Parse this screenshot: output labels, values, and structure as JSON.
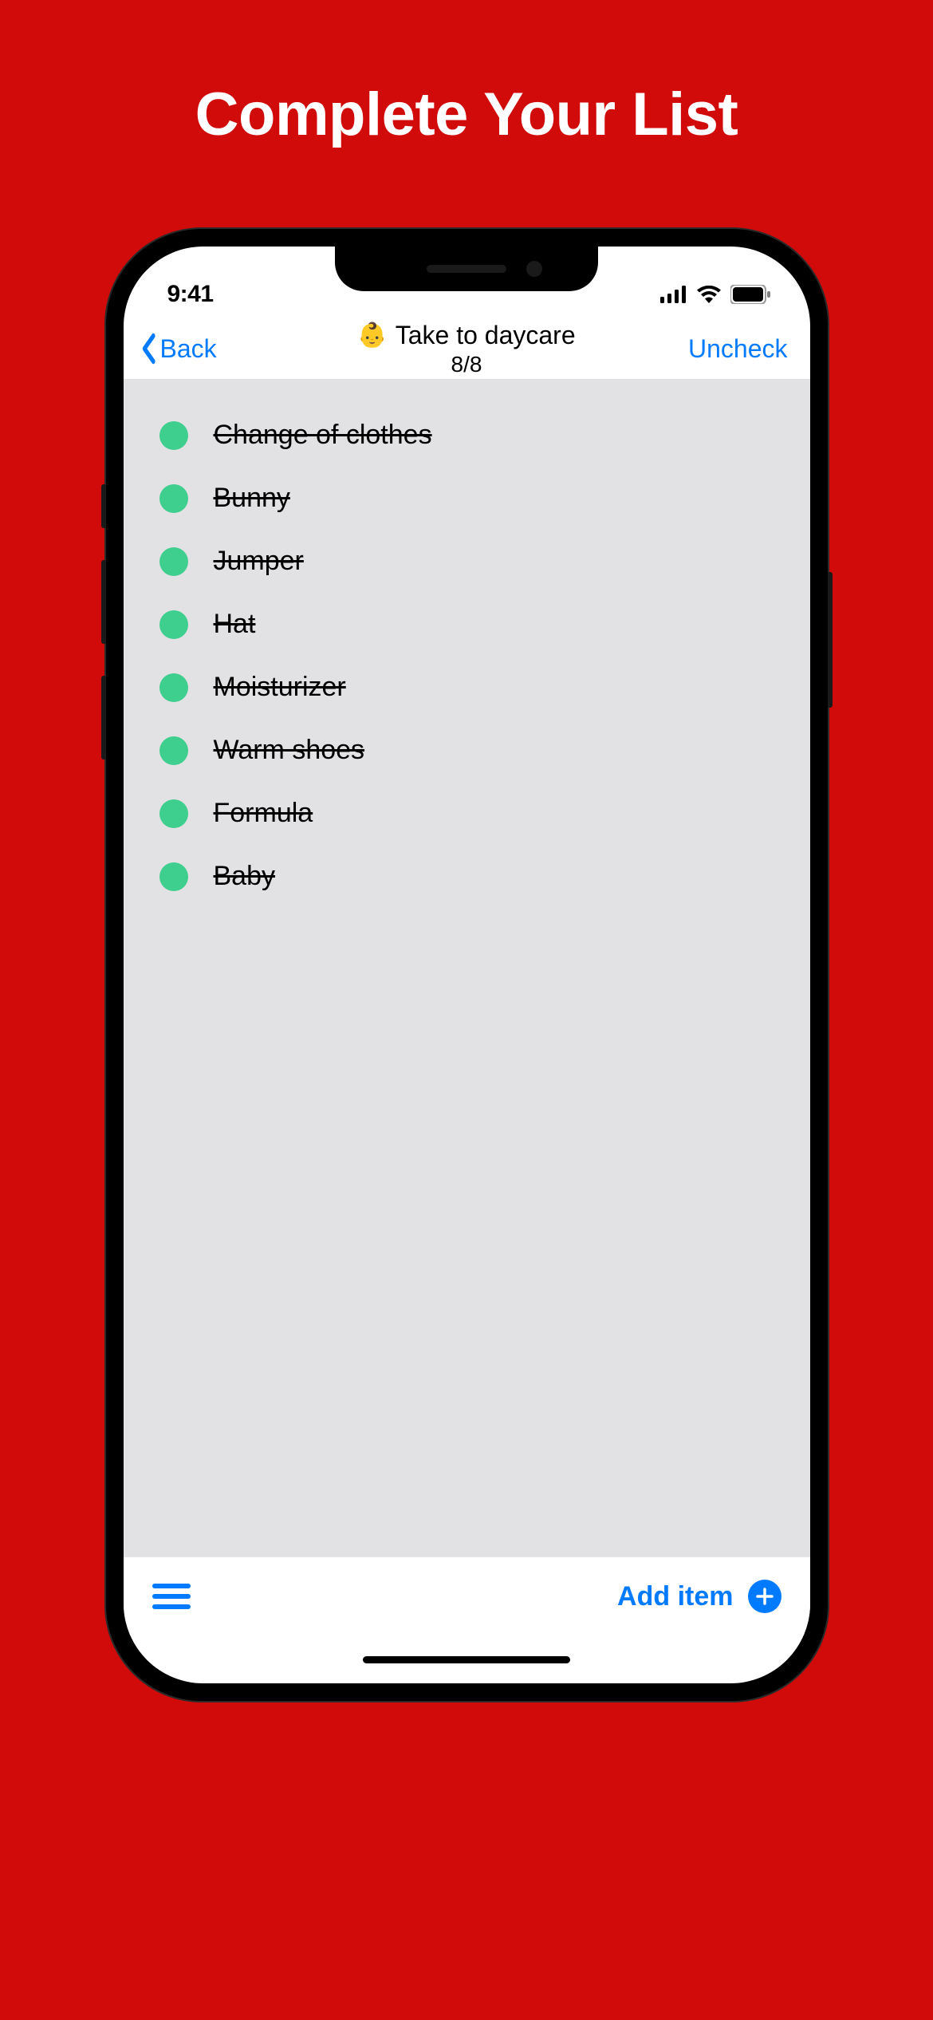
{
  "promo": {
    "title": "Complete Your List"
  },
  "statusBar": {
    "time": "9:41"
  },
  "nav": {
    "backLabel": "Back",
    "emoji": "👶",
    "title": "Take to daycare",
    "counter": "8/8",
    "uncheckLabel": "Uncheck"
  },
  "list": {
    "items": [
      {
        "label": "Change of clothes",
        "checked": true
      },
      {
        "label": "Bunny",
        "checked": true
      },
      {
        "label": "Jumper",
        "checked": true
      },
      {
        "label": "Hat",
        "checked": true
      },
      {
        "label": "Moisturizer",
        "checked": true
      },
      {
        "label": "Warm shoes",
        "checked": true
      },
      {
        "label": "Formula",
        "checked": true
      },
      {
        "label": "Baby",
        "checked": true
      }
    ]
  },
  "toolbar": {
    "addItemLabel": "Add item"
  },
  "colors": {
    "background": "#d10a0a",
    "accent": "#007aff",
    "checked": "#3ecf8e",
    "listBg": "#e2e2e4"
  }
}
